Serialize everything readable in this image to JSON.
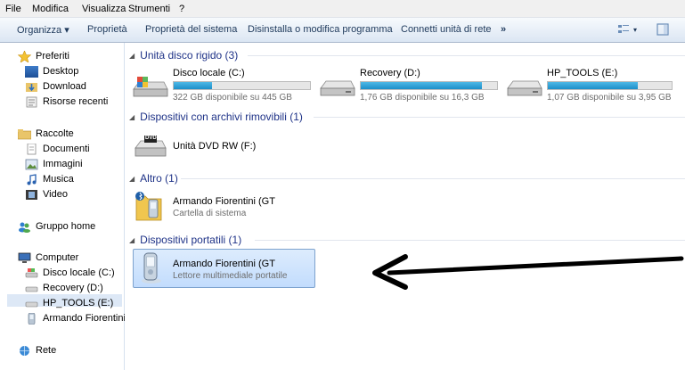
{
  "menu": [
    "File",
    "Modifica",
    "Visualizza",
    "Strumenti",
    "?"
  ],
  "toolbar": {
    "organize": "Organizza ▾",
    "items": [
      "Proprietà",
      "Proprietà del sistema",
      "Disinstalla o modifica programma",
      "Connetti unità di rete"
    ],
    "more": "»"
  },
  "nav": {
    "favorites": "Preferiti",
    "fav_items": [
      "Desktop",
      "Download",
      "Risorse recenti"
    ],
    "libraries": "Raccolte",
    "lib_items": [
      "Documenti",
      "Immagini",
      "Musica",
      "Video"
    ],
    "homegroup": "Gruppo home",
    "computer": "Computer",
    "comp_items": [
      "Disco locale (C:)",
      "Recovery (D:)",
      "HP_TOOLS (E:)",
      "Armando Fiorentini"
    ],
    "network": "Rete"
  },
  "groups": {
    "hdd": "Unità disco rigido (3)",
    "removable": "Dispositivi con archivi rimovibili (1)",
    "other": "Altro (1)",
    "portable": "Dispositivi portatili (1)"
  },
  "drives": [
    {
      "name": "Disco locale (C:)",
      "free": "322 GB disponibile su 445 GB",
      "used_fraction": 0.28
    },
    {
      "name": "Recovery (D:)",
      "free": "1,76 GB disponibile su 16,3 GB",
      "used_fraction": 0.89
    },
    {
      "name": "HP_TOOLS (E:)",
      "free": "1,07 GB disponibile su 3,95 GB",
      "used_fraction": 0.73
    }
  ],
  "dvd": {
    "name": "Unità DVD RW (F:)",
    "badge": "DVD"
  },
  "other_item": {
    "name": "Armando Fiorentini (GT",
    "sub": "Cartella di sistema"
  },
  "portable_item": {
    "name": "Armando Fiorentini (GT",
    "sub": "Lettore multimediale portatile"
  },
  "colors": {
    "accent": "#1e3287",
    "selection": "#c2dcfd",
    "bar_fill": "#26a0da",
    "arrow": "#000000"
  }
}
